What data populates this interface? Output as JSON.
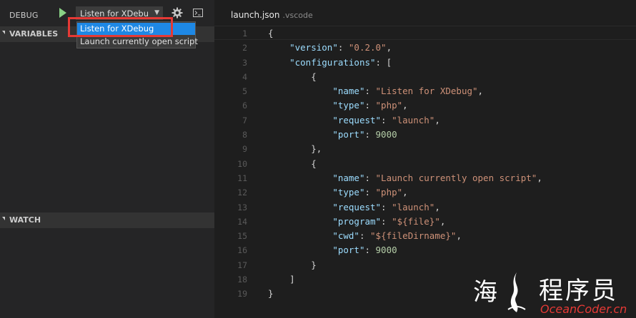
{
  "debug": {
    "title": "DEBUG",
    "configuration": "Listen for XDebu",
    "dropdown_options": [
      "Listen for XDebug",
      "Launch currently open script"
    ],
    "selected_option": "Listen for XDebug"
  },
  "sidebar": {
    "variables_label": "VARIABLES",
    "watch_label": "WATCH"
  },
  "editor": {
    "file_name": "launch.json",
    "folder": ".vscode",
    "lines": [
      [
        {
          "t": "p",
          "v": "{"
        }
      ],
      [
        {
          "t": "p",
          "v": "    "
        },
        {
          "t": "k",
          "v": "\"version\""
        },
        {
          "t": "p",
          "v": ": "
        },
        {
          "t": "s",
          "v": "\"0.2.0\""
        },
        {
          "t": "p",
          "v": ","
        }
      ],
      [
        {
          "t": "p",
          "v": "    "
        },
        {
          "t": "k",
          "v": "\"configurations\""
        },
        {
          "t": "p",
          "v": ": ["
        }
      ],
      [
        {
          "t": "p",
          "v": "        {"
        }
      ],
      [
        {
          "t": "p",
          "v": "            "
        },
        {
          "t": "k",
          "v": "\"name\""
        },
        {
          "t": "p",
          "v": ": "
        },
        {
          "t": "s",
          "v": "\"Listen for XDebug\""
        },
        {
          "t": "p",
          "v": ","
        }
      ],
      [
        {
          "t": "p",
          "v": "            "
        },
        {
          "t": "k",
          "v": "\"type\""
        },
        {
          "t": "p",
          "v": ": "
        },
        {
          "t": "s",
          "v": "\"php\""
        },
        {
          "t": "p",
          "v": ","
        }
      ],
      [
        {
          "t": "p",
          "v": "            "
        },
        {
          "t": "k",
          "v": "\"request\""
        },
        {
          "t": "p",
          "v": ": "
        },
        {
          "t": "s",
          "v": "\"launch\""
        },
        {
          "t": "p",
          "v": ","
        }
      ],
      [
        {
          "t": "p",
          "v": "            "
        },
        {
          "t": "k",
          "v": "\"port\""
        },
        {
          "t": "p",
          "v": ": "
        },
        {
          "t": "n",
          "v": "9000"
        }
      ],
      [
        {
          "t": "p",
          "v": "        },"
        }
      ],
      [
        {
          "t": "p",
          "v": "        {"
        }
      ],
      [
        {
          "t": "p",
          "v": "            "
        },
        {
          "t": "k",
          "v": "\"name\""
        },
        {
          "t": "p",
          "v": ": "
        },
        {
          "t": "s",
          "v": "\"Launch currently open script\""
        },
        {
          "t": "p",
          "v": ","
        }
      ],
      [
        {
          "t": "p",
          "v": "            "
        },
        {
          "t": "k",
          "v": "\"type\""
        },
        {
          "t": "p",
          "v": ": "
        },
        {
          "t": "s",
          "v": "\"php\""
        },
        {
          "t": "p",
          "v": ","
        }
      ],
      [
        {
          "t": "p",
          "v": "            "
        },
        {
          "t": "k",
          "v": "\"request\""
        },
        {
          "t": "p",
          "v": ": "
        },
        {
          "t": "s",
          "v": "\"launch\""
        },
        {
          "t": "p",
          "v": ","
        }
      ],
      [
        {
          "t": "p",
          "v": "            "
        },
        {
          "t": "k",
          "v": "\"program\""
        },
        {
          "t": "p",
          "v": ": "
        },
        {
          "t": "s",
          "v": "\"${file}\""
        },
        {
          "t": "p",
          "v": ","
        }
      ],
      [
        {
          "t": "p",
          "v": "            "
        },
        {
          "t": "k",
          "v": "\"cwd\""
        },
        {
          "t": "p",
          "v": ": "
        },
        {
          "t": "s",
          "v": "\"${fileDirname}\""
        },
        {
          "t": "p",
          "v": ","
        }
      ],
      [
        {
          "t": "p",
          "v": "            "
        },
        {
          "t": "k",
          "v": "\"port\""
        },
        {
          "t": "p",
          "v": ": "
        },
        {
          "t": "n",
          "v": "9000"
        }
      ],
      [
        {
          "t": "p",
          "v": "        }"
        }
      ],
      [
        {
          "t": "p",
          "v": "    ]"
        }
      ],
      [
        {
          "t": "p",
          "v": "}"
        }
      ]
    ]
  },
  "watermark": {
    "logo_char": "海",
    "title": "程序员",
    "subtitle": "OceanCoder.cn"
  },
  "colors": {
    "start_icon": "#89d185",
    "selection": "#1e88e5",
    "highlight": "#e53935",
    "json_key": "#9cdcfe",
    "json_string": "#ce9178",
    "json_number": "#b5cea8"
  }
}
